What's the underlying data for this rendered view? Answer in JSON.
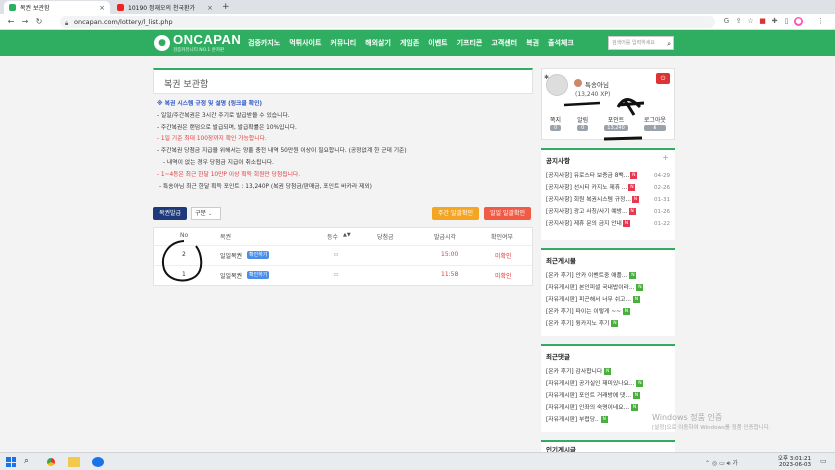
{
  "browser": {
    "tabs": [
      {
        "title": "복권 보관함",
        "active": true
      },
      {
        "title": "10190 정재오의 천국환가 ",
        "active": false
      }
    ],
    "new_tab": "+",
    "url": "oncapan.com/lottery/l_list.php"
  },
  "site": {
    "logo": "ONCAPAN",
    "logo_sub": "검증커뮤니티 NO.1 온카판",
    "menu": [
      "검증카지노",
      "먹튀사이트",
      "커뮤니티",
      "해외살기",
      "게임존",
      "이벤트",
      "기프티콘",
      "고객센터",
      "복권",
      "출석체크"
    ],
    "search_placeholder": "검색어를 입력하세요"
  },
  "lottery": {
    "title": "복권 보관함",
    "rules_header": "※ 복권 시스템 규정 및 설명 (링크클 확인)",
    "rules": [
      {
        "text": "- 일일/주간복권은 3시간 주기로 발급받을 수 있습니다.",
        "style": "normal"
      },
      {
        "text": "- 주간복권은 랜덤으로 발급되며, 발급확률은 10%입니다.",
        "style": "normal"
      },
      {
        "text": "- 1일 기준 최대 100장까지 확인 가능합니다.",
        "style": "red"
      },
      {
        "text": "- 주간복권 당첨금 지급을 위해서는 양홀 충전 내역 50만원 이상이 필요합니다. (공정없계 한 군데 기준)",
        "style": "normal"
      },
      {
        "text": "  - 내역이 없는 경우 당첨금 지급이 취소됩니다.",
        "style": "normal"
      },
      {
        "text": "- 1~4등은 최근 한달 10만P 이상 획득 회원만 당첨됩니다.",
        "style": "red"
      },
      {
        "text": "  - 특송아님 최근 한달 획득 포인트 : 13,240P (복권 당첨금/판매금, 포인트 바카라 제외)",
        "style": "normal"
      }
    ],
    "issue_button": "복권발급",
    "filter_value": "구분",
    "weekly_button": "주간 일괄확인",
    "daily_button": "일일 일괄확인",
    "columns": [
      "No",
      "복권",
      "등수",
      "당첨금",
      "발급시각",
      "확인여부"
    ],
    "rows": [
      {
        "no": "2",
        "type": "일일복권",
        "tag": "확인하기",
        "time": "15:00",
        "status": "미확인"
      },
      {
        "no": "1",
        "type": "일일복권",
        "tag": "확인하기",
        "time": "11:58",
        "status": "미확인"
      }
    ]
  },
  "profile": {
    "name": "특송아님",
    "xp": "(13,240 XP)",
    "stats": [
      {
        "label": "쪽지",
        "value": "0"
      },
      {
        "label": "알림",
        "value": "0"
      },
      {
        "label": "포인트",
        "value": "13,240"
      },
      {
        "label": "로그아웃",
        "value": ""
      }
    ]
  },
  "notices": {
    "title": "공지사항",
    "more": "+",
    "items": [
      {
        "text": "[공지사항] 유로스타 보증금 8백...",
        "date": "04-29"
      },
      {
        "text": "[공지사항] 선시티 카지노 제휴 ...",
        "date": "02-26"
      },
      {
        "text": "[공지사항] 회원 복권시스템 규정...",
        "date": "01-31"
      },
      {
        "text": "[공지사항] 광고 사칭/사기 예방...",
        "date": "01-26"
      },
      {
        "text": "[공지사항] 제휴 문의 금지 안내",
        "date": "01-22"
      }
    ]
  },
  "recent_posts": {
    "title": "최근게시물",
    "items": [
      {
        "text": "[온카 후기] 안카 이벤트중 애플...",
        "badge": "N"
      },
      {
        "text": "[자유게시판] 본인피셜 국내밥이라...",
        "badge": "N"
      },
      {
        "text": "[자유게시판] 피곤해서 너무 쉬고...",
        "badge": "N"
      },
      {
        "text": "[온카 후기] 파이는 이렇게 ~~",
        "badge": "N"
      },
      {
        "text": "[온카 후기] 뒹카지노 후기",
        "badge": "N"
      }
    ]
  },
  "recent_comments": {
    "title": "최근댓글",
    "items": [
      {
        "text": "[온카 후기] 감사합니다",
        "badge": "N"
      },
      {
        "text": "[자유게시판] 공가실인 재미있나요...",
        "badge": "N"
      },
      {
        "text": "[자유게시판] 포인트 거래방에 댓...",
        "badge": "N"
      },
      {
        "text": "[자유게시판] 인좌의 숙명이네요...",
        "badge": "N"
      },
      {
        "text": "[자유게시판] 부럽당..",
        "badge": "N"
      }
    ]
  },
  "next_section": "인기게시글",
  "watermark": {
    "line1": "Windows 정품 인증",
    "line2": "[설정]으로 이동하여 Windows를 정품 인증합니다."
  },
  "taskbar": {
    "time": "오후 3:01:21",
    "date": "2023-06-03"
  },
  "colors": {
    "brand": "#2fae62",
    "red": "#e43a3a",
    "blue": "#2c55c9",
    "orange": "#f3a523",
    "coral": "#ef5b45"
  }
}
